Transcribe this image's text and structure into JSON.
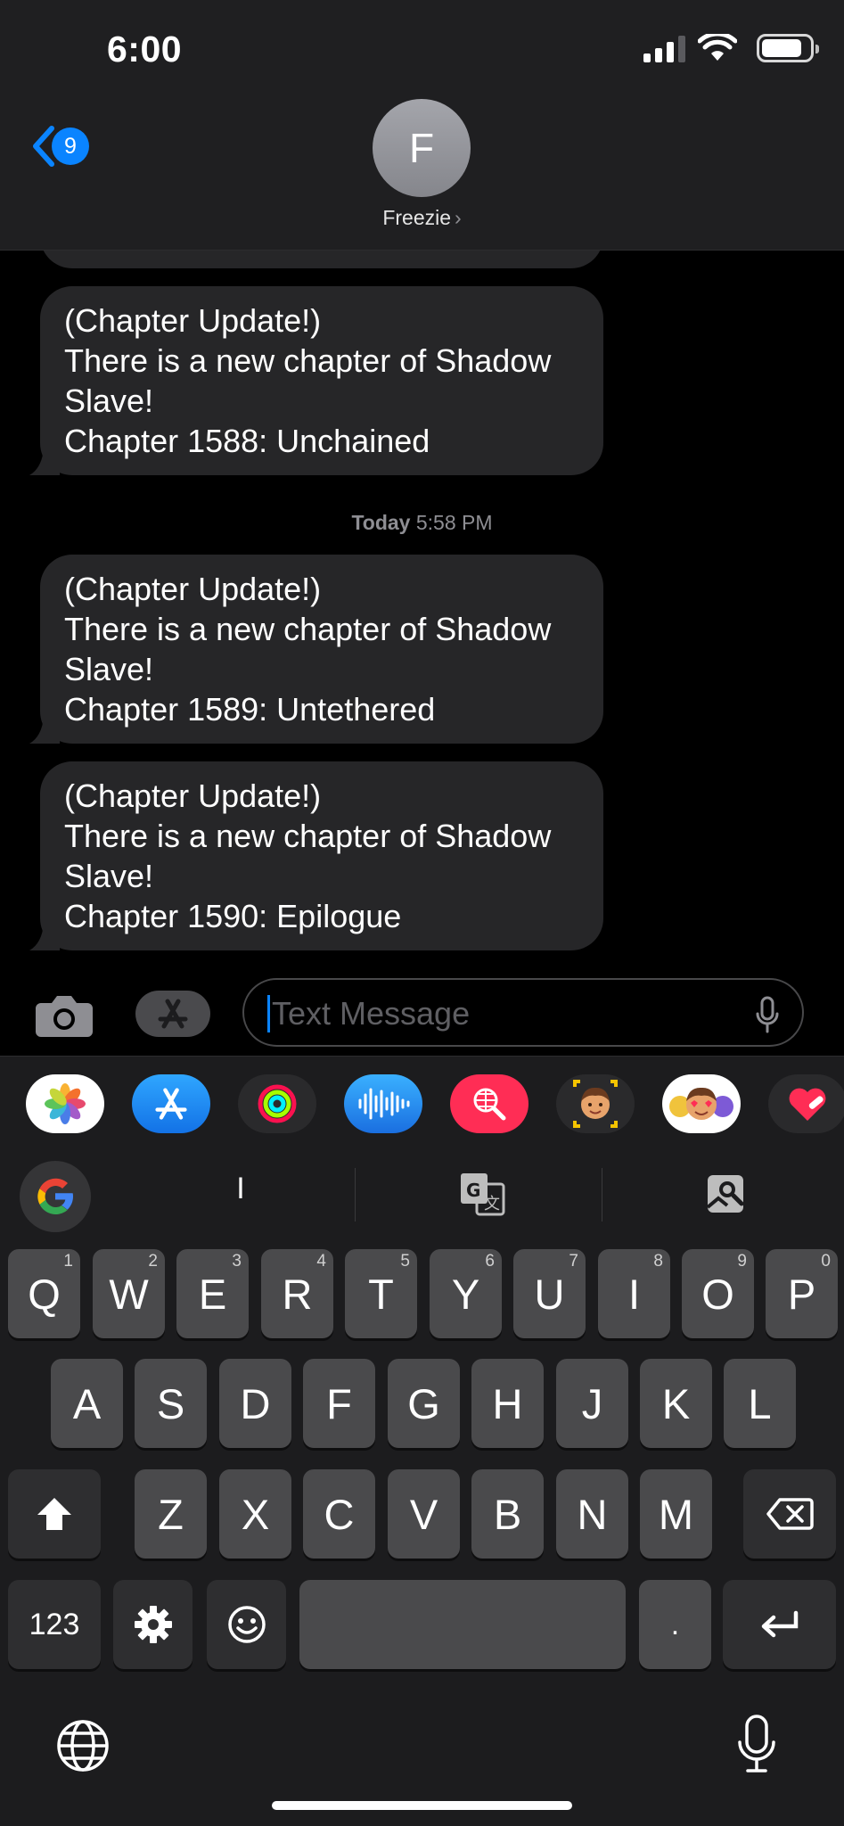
{
  "status": {
    "time": "6:00"
  },
  "header": {
    "back_count": "9",
    "avatar_initial": "F",
    "contact_name": "Freezie",
    "chevron": "›"
  },
  "messages": [
    {
      "lines": [
        "(Chapter Update!)",
        "There is a new chapter of Shadow",
        "Slave!",
        "Chapter 1588: Unchained"
      ]
    },
    {
      "lines": [
        "(Chapter Update!)",
        "There is a new chapter of Shadow",
        "Slave!",
        "Chapter 1589: Untethered"
      ]
    },
    {
      "lines": [
        "(Chapter Update!)",
        "There is a new chapter of Shadow",
        "Slave!",
        "Chapter 1590: Epilogue"
      ]
    }
  ],
  "timestamp": {
    "day": "Today",
    "time": "5:58 PM"
  },
  "input": {
    "placeholder": "Text Message"
  },
  "app_strip": [
    "photos-icon",
    "app-store-icon",
    "activity-icon",
    "voice-memo-icon",
    "search-globe-icon",
    "memoji-icon",
    "memoji-stickers-icon",
    "heart-sticker-icon"
  ],
  "keyboard": {
    "suggestion": "I",
    "row1": [
      {
        "key": "Q",
        "hint": "1"
      },
      {
        "key": "W",
        "hint": "2"
      },
      {
        "key": "E",
        "hint": "3"
      },
      {
        "key": "R",
        "hint": "4"
      },
      {
        "key": "T",
        "hint": "5"
      },
      {
        "key": "Y",
        "hint": "6"
      },
      {
        "key": "U",
        "hint": "7"
      },
      {
        "key": "I",
        "hint": "8"
      },
      {
        "key": "O",
        "hint": "9"
      },
      {
        "key": "P",
        "hint": "0"
      }
    ],
    "row2": [
      "A",
      "S",
      "D",
      "F",
      "G",
      "H",
      "J",
      "K",
      "L"
    ],
    "row3": [
      "Z",
      "X",
      "C",
      "V",
      "B",
      "N",
      "M"
    ],
    "numbers_label": "123",
    "period_label": "."
  },
  "colors": {
    "accent": "#0a84ff",
    "bubble": "#262628",
    "key": "#4a4a4c",
    "key_dark": "#2e2e30"
  }
}
